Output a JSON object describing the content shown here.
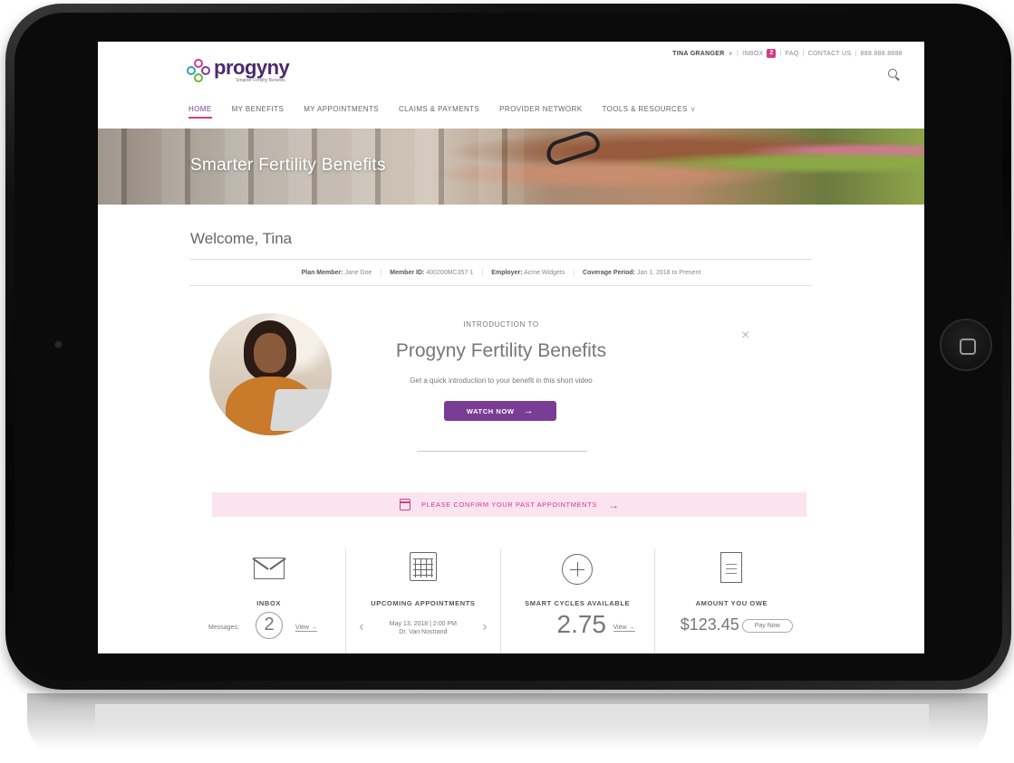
{
  "topbar": {
    "user": "TINA GRANGER",
    "user_chevron": "∨",
    "inbox_label": "INBOX",
    "inbox_count": "2",
    "faq": "FAQ",
    "contact": "CONTACT US",
    "phone": "888.888.8888",
    "sep": "|"
  },
  "logo": {
    "word": "progyny",
    "tagline": "Smarter Fertility Benefits"
  },
  "nav": {
    "items": [
      {
        "label": "HOME"
      },
      {
        "label": "MY BENEFITS"
      },
      {
        "label": "MY APPOINTMENTS"
      },
      {
        "label": "CLAIMS & PAYMENTS"
      },
      {
        "label": "PROVIDER NETWORK"
      },
      {
        "label": "TOOLS & RESOURCES"
      }
    ],
    "tools_chevron": "∨"
  },
  "hero": {
    "title": "Smarter Fertility Benefits"
  },
  "welcome": "Welcome, Tina",
  "member": {
    "plan_label": "Plan Member:",
    "plan_value": "Jane Doe",
    "id_label": "Member ID:",
    "id_value": "400200MC357-1",
    "employer_label": "Employer:",
    "employer_value": "Acme Widgets",
    "coverage_label": "Coverage Period:",
    "coverage_value": "Jan 1, 2018 to Present",
    "sep": "|"
  },
  "intro": {
    "kicker": "INTRODUCTION TO",
    "title": "Progyny Fertility Benefits",
    "description": "Get a quick introduction to your benefit in this short video",
    "button": "WATCH NOW",
    "button_arrow": "→",
    "close": "×"
  },
  "confirm": {
    "text": "PLEASE CONFIRM YOUR PAST APPOINTMENTS",
    "arrow": "→"
  },
  "tiles": {
    "inbox": {
      "title": "INBOX",
      "messages_label": "Messages:",
      "count": "2",
      "view": "View →"
    },
    "appointments": {
      "title": "UPCOMING APPOINTMENTS",
      "date": "May 13, 2018 | 2:00 PM",
      "doctor": "Dr. Van Nostrand",
      "prev": "‹",
      "next": "›"
    },
    "cycles": {
      "title": "SMART CYCLES AVAILABLE",
      "value": "2.75",
      "view": "View →"
    },
    "owe": {
      "title": "AMOUNT YOU OWE",
      "amount": "$123.45",
      "pay": "Pay Now"
    }
  },
  "colors": {
    "brand_purple": "#7a3d96",
    "brand_pink": "#d63a86",
    "confirm_bg": "#fbe4ef"
  }
}
